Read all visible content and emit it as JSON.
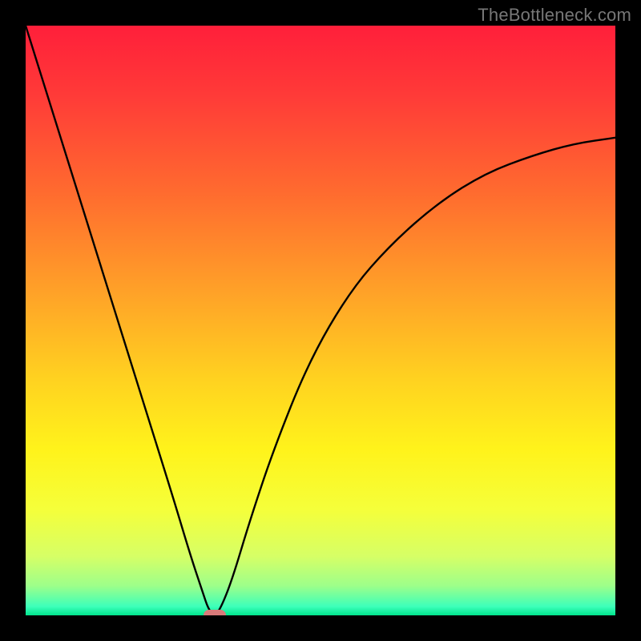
{
  "watermark": "TheBottleneck.com",
  "chart_data": {
    "type": "line",
    "title": "",
    "xlabel": "",
    "ylabel": "",
    "xlim": [
      0,
      100
    ],
    "ylim": [
      0,
      100
    ],
    "grid": false,
    "legend": false,
    "series": [
      {
        "name": "bottleneck-curve",
        "x": [
          0,
          5,
          10,
          15,
          20,
          25,
          28,
          30,
          31,
          32,
          33,
          35,
          38,
          42,
          48,
          55,
          62,
          70,
          78,
          86,
          93,
          100
        ],
        "y": [
          100,
          84,
          68,
          52,
          36,
          20,
          10,
          4,
          1,
          0,
          1,
          6,
          16,
          28,
          43,
          55,
          63,
          70,
          75,
          78,
          80,
          81
        ]
      }
    ],
    "marker": {
      "x": 32,
      "y": 0
    },
    "gradient_stops": [
      {
        "offset": 0.0,
        "color": "#ff1f3a"
      },
      {
        "offset": 0.12,
        "color": "#ff3b38"
      },
      {
        "offset": 0.28,
        "color": "#ff6a2f"
      },
      {
        "offset": 0.45,
        "color": "#ffa128"
      },
      {
        "offset": 0.6,
        "color": "#ffd220"
      },
      {
        "offset": 0.72,
        "color": "#fff31b"
      },
      {
        "offset": 0.82,
        "color": "#f5ff3a"
      },
      {
        "offset": 0.9,
        "color": "#d6ff66"
      },
      {
        "offset": 0.95,
        "color": "#9dff8a"
      },
      {
        "offset": 0.985,
        "color": "#3dffba"
      },
      {
        "offset": 1.0,
        "color": "#00e58d"
      }
    ]
  }
}
